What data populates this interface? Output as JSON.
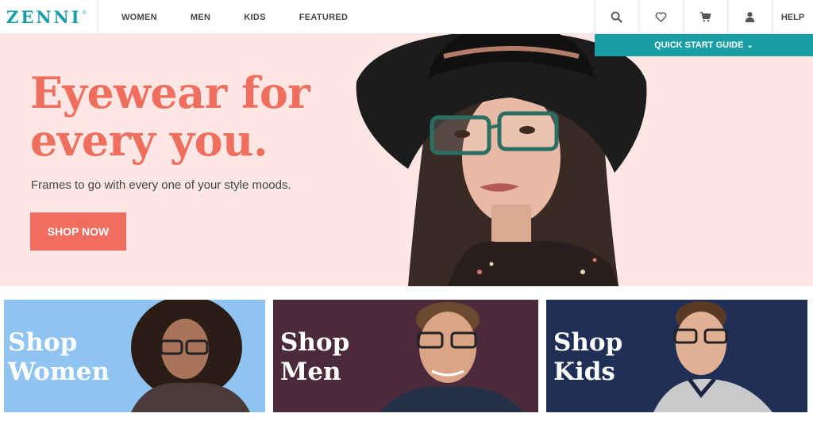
{
  "header": {
    "logo": "ZENNI",
    "logo_mark": "®",
    "nav": [
      "WOMEN",
      "MEN",
      "KIDS",
      "FEATURED"
    ],
    "icons": [
      "search-icon",
      "heart-icon",
      "cart-icon",
      "user-icon"
    ],
    "help": "HELP"
  },
  "quickstart": {
    "label": "QUICK START GUIDE",
    "chevron": "⌄"
  },
  "hero": {
    "title": "Eyewear for\nevery you.",
    "subtitle": "Frames to go with every one of your style moods.",
    "cta": "SHOP NOW"
  },
  "tiles": {
    "women": "Shop\nWomen",
    "men": "Shop\nMen",
    "kids": "Shop\nKids"
  },
  "colors": {
    "brand_teal": "#1a9ea6",
    "coral": "#ef6f5f",
    "hero_bg": "#fde6e4",
    "women_bg": "#8fc4f0",
    "men_bg": "#4b2b3a",
    "kids_bg": "#1f2f55"
  }
}
